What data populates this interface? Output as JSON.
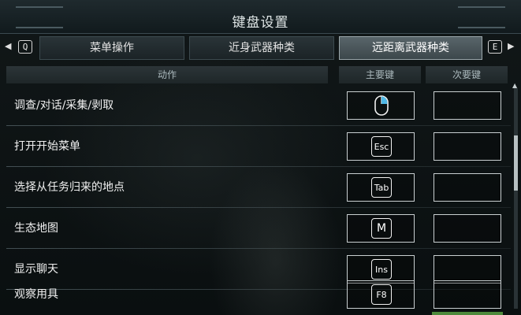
{
  "header": {
    "title": "键盘设置"
  },
  "tabs": {
    "prev_key": "Q",
    "next_key": "E",
    "items": [
      {
        "label": "菜单操作",
        "active": false
      },
      {
        "label": "近身武器种类",
        "active": false
      },
      {
        "label": "远距离武器种类",
        "active": true
      }
    ]
  },
  "columns": {
    "action": "动作",
    "primary": "主要键",
    "secondary": "次要键"
  },
  "rows": [
    {
      "label": "调查/对话/采集/剥取",
      "primary": "mouse-right-icon",
      "secondary": ""
    },
    {
      "label": "打开开始菜单",
      "primary": "Esc",
      "secondary": ""
    },
    {
      "label": "选择从任务归来的地点",
      "primary": "Tab",
      "secondary": ""
    },
    {
      "label": "生态地图",
      "primary": "M",
      "secondary": ""
    },
    {
      "label": "显示聊天",
      "primary": "Ins",
      "secondary": ""
    },
    {
      "label": "观察用具",
      "primary": "F8",
      "secondary": ""
    }
  ],
  "colors": {
    "active_tab": "#59656a",
    "accent_bottom": "#4e8a3c"
  }
}
